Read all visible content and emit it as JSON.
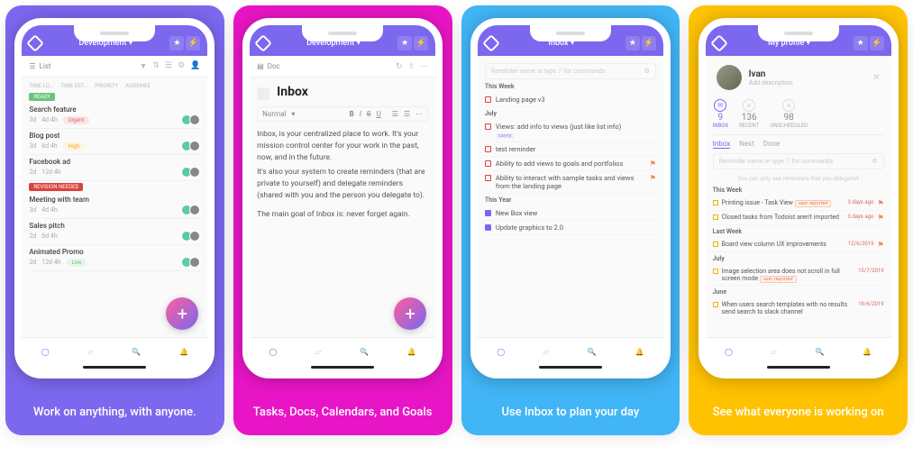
{
  "cards": [
    {
      "caption": "Work on anything, with anyone."
    },
    {
      "caption": "Tasks, Docs, Calendars, and Goals"
    },
    {
      "caption": "Use Inbox to plan your day"
    },
    {
      "caption": "See what everyone is working on"
    }
  ],
  "screen1": {
    "topTitle": "Development",
    "viewMode": "List",
    "cols": [
      "TIME LO...",
      "TIME EST...",
      "PRIORITY",
      "ASSIGNEE"
    ],
    "group1": "READY",
    "group2": "REVISION NEEDED",
    "tasks1": [
      {
        "title": "Search feature",
        "t1": "3d",
        "t2": "4d 4h",
        "prio": "Urgent",
        "prioClass": ""
      },
      {
        "title": "Blog post",
        "t1": "3d",
        "t2": "6d 4h",
        "prio": "High",
        "prioClass": "prio-high"
      },
      {
        "title": "Facebook ad",
        "t1": "2d",
        "t2": "12d 4h",
        "prio": "",
        "prioClass": ""
      }
    ],
    "tasks2": [
      {
        "title": "Meeting with team",
        "t1": "3d",
        "t2": "4d 4h",
        "prio": "",
        "prioClass": ""
      },
      {
        "title": "Sales pitch",
        "t1": "2d",
        "t2": "6d 4h",
        "prio": "",
        "prioClass": ""
      },
      {
        "title": "Animated Promo",
        "t1": "2d",
        "t2": "12d 4h",
        "prio": "Live",
        "prioClass": "prio-live"
      }
    ]
  },
  "screen2": {
    "topTitle": "Development",
    "viewMode": "Doc",
    "docTitle": "Inbox",
    "toolNormal": "Normal",
    "para1": "Inbox, is your centralized place to work. It's your mission control center for your work in the past, now, and in the future.",
    "para2": "It's also your system to create reminders (that are private to yourself) and delegate reminders (shared with you and the person you delegate to).",
    "para3": "The main goal of Inbox is: never forget again."
  },
  "screen3": {
    "topTitle": "Inbox",
    "placeholder": "Reminder name or type '/' for commands",
    "sections": {
      "thisWeek": "This Week",
      "july": "July",
      "thisYear": "This Year"
    },
    "thisWeek": [
      {
        "t": "Landing page v3"
      }
    ],
    "july": [
      {
        "t": "Views: add info to views (just like list info)",
        "tag": "canny"
      },
      {
        "t": "test reminder"
      },
      {
        "t": "Ability to add views to goals and portfolios",
        "flag": true
      },
      {
        "t": "Ability to interact with sample tasks and views from the landing page",
        "flag": true
      }
    ],
    "thisYear": [
      {
        "t": "New Box view"
      },
      {
        "t": "Update graphics to 2.0"
      }
    ]
  },
  "screen4": {
    "topTitle": "My profile",
    "name": "Ivan",
    "desc": "Add description",
    "stats": [
      {
        "n": "9",
        "l": "INBOX",
        "active": true
      },
      {
        "n": "136",
        "l": "RECENT"
      },
      {
        "n": "98",
        "l": "UNSCHEDULED"
      }
    ],
    "tabs": [
      "Inbox",
      "Next",
      "Done"
    ],
    "activeTab": 0,
    "placeholder": "Reminder name or type '/' for commands",
    "note": "You can only see reminders that you delegated",
    "groups": {
      "thisWeek": "This Week",
      "lastWeek": "Last Week",
      "july": "July",
      "june": "June"
    },
    "thisWeek": [
      {
        "t": "Printing issue - Task View",
        "tag": "user reported",
        "date": "3 days ago",
        "flag": true
      },
      {
        "t": "Closed tasks from Todoist aren't imported",
        "date": "3 days ago",
        "flag": true
      }
    ],
    "lastWeek": [
      {
        "t": "Board view column UX improvements",
        "date": "12/6/2019",
        "flag": true
      }
    ],
    "july": [
      {
        "t": "Image selection area does not scroll in full screen mode",
        "tag": "user reported",
        "date": "15/7/2019"
      }
    ],
    "june": [
      {
        "t": "When users search templates with no results send search to slack channel",
        "date": "19/6/2019"
      }
    ]
  }
}
